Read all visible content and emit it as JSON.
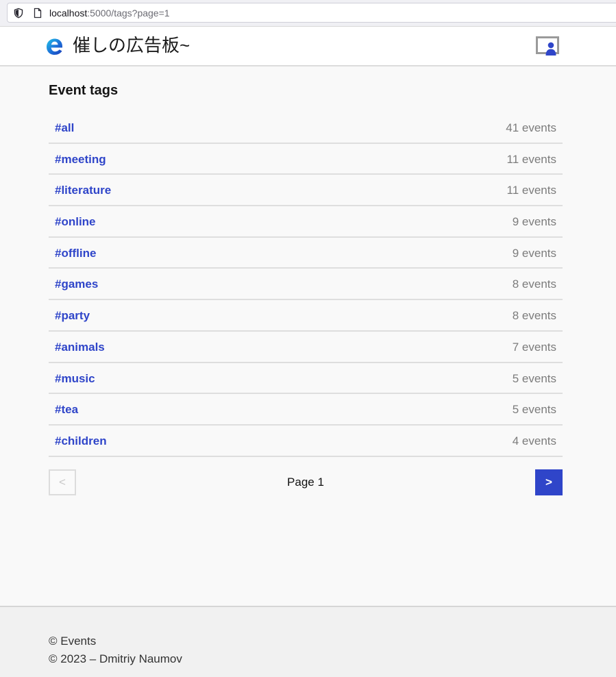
{
  "browser": {
    "url_host": "localhost",
    "url_rest": ":5000/tags?page=1"
  },
  "header": {
    "site_title": "催しの広告板~"
  },
  "main": {
    "title": "Event tags",
    "tags": [
      {
        "label": "#all",
        "count": "41 events"
      },
      {
        "label": "#meeting",
        "count": "11 events"
      },
      {
        "label": "#literature",
        "count": "11 events"
      },
      {
        "label": "#online",
        "count": "9 events"
      },
      {
        "label": "#offline",
        "count": "9 events"
      },
      {
        "label": "#games",
        "count": "8 events"
      },
      {
        "label": "#party",
        "count": "8 events"
      },
      {
        "label": "#animals",
        "count": "7 events"
      },
      {
        "label": "#music",
        "count": "5 events"
      },
      {
        "label": "#tea",
        "count": "5 events"
      },
      {
        "label": "#children",
        "count": "4 events"
      }
    ]
  },
  "pagination": {
    "prev_label": "<",
    "page_label": "Page 1",
    "next_label": ">"
  },
  "footer": {
    "line1": "© Events",
    "line2": "© 2023 – Dmitriy Naumov"
  },
  "colors": {
    "accent": "#2f45c9",
    "count_text": "#7c7c7c",
    "page_bg": "#f9f9f9"
  },
  "icons": {
    "shield": "shield-icon",
    "page": "page-icon",
    "logo": "logo-icon",
    "avatar": "avatar-icon"
  }
}
